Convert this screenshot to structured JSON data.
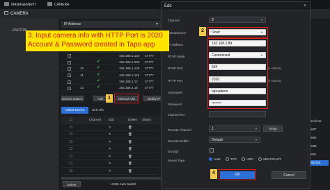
{
  "topbar": {
    "tabs": [
      {
        "label": "MANAGEMENT"
      },
      {
        "label": "CAMERA"
      }
    ],
    "close_label": "×"
  },
  "subbar": {
    "title": "CAMERA"
  },
  "sidebar": {
    "items": [
      {
        "label": "ENCODE"
      }
    ]
  },
  "main": {
    "ip_filter": {
      "value": "IP Address"
    },
    "device_rows": [
      {
        "num": "",
        "ip": "",
        "port": ""
      },
      {
        "num": "",
        "ip": "",
        "port": ""
      },
      {
        "num": "",
        "ip": "",
        "port": ""
      },
      {
        "num": "",
        "ip": "192.168.1.123",
        "port": "37777"
      },
      {
        "num": "",
        "ip": "192.168.1.233",
        "port": "37777"
      },
      {
        "num": "10",
        "ip": "192.168.1.128",
        "port": "37777"
      },
      {
        "num": "11",
        "ip": "192.168.1.119",
        "port": "37777"
      },
      {
        "num": "",
        "ip": "192.168.1.12",
        "port": "37777"
      },
      {
        "num": "13",
        "ip": "192.168.1.16",
        "port": "37777"
      }
    ],
    "buttons": {
      "device_search": "Device Search",
      "add": "Add",
      "manual_add": "Manual Add",
      "modify_ip": "Modify IP"
    },
    "tabs": {
      "added_device": "Added Device",
      "link_info": "Link Info"
    },
    "table_headers": {
      "channel": "Channel",
      "edit": "Edit",
      "delete": "Delete",
      "status": "Status"
    },
    "footer": {
      "delete": "Delete",
      "h265": "H.265 Auto Switch"
    }
  },
  "right_panel": {
    "rows": [
      "Serial No.",
      "7M07",
      "7M60",
      "7M28",
      "7M91",
      "WN7325"
    ]
  },
  "dialog": {
    "title": "Edit",
    "close": "×",
    "fields": {
      "channel": {
        "label": "Channel",
        "value": "8"
      },
      "manufacturer": {
        "label": "Manufacturer",
        "value": "Onvif"
      },
      "ip_address": {
        "label": "IP Address",
        "value": "192.168.2.89"
      },
      "rtsp_mode": {
        "label": "RTSP Mode",
        "value": "Customized"
      },
      "rtsp_port": {
        "label": "RTSP Port",
        "value": "554",
        "hint": "(1~65535)"
      },
      "http_port": {
        "label": "HTTP Port",
        "value": "2020",
        "hint": "(1~65535)"
      },
      "username": {
        "label": "Username",
        "value": "tapoadmin"
      },
      "password": {
        "label": "Password",
        "value": "••••••••"
      },
      "channel_no": {
        "label": "Channel No.",
        "value": ""
      },
      "remote_channel": {
        "label": "Remote Channel",
        "value": "1"
      },
      "decoder_buffer": {
        "label": "Decoder Buffer",
        "value": "Default"
      },
      "encrypt": {
        "label": "Encrypt"
      },
      "server_type": {
        "label": "Server Type",
        "options": [
          "Auto",
          "TCP",
          "UDP",
          "MULTICAST"
        ],
        "selected": "Auto"
      }
    },
    "setup_label": "Setup",
    "ok_label": "OK",
    "cancel_label": "Cancel"
  },
  "annotations": {
    "text_line1": "3. Input camera info with HTTP Port is 2020",
    "text_line2": "Account & Password created in Tapo app",
    "markers": {
      "m1": "1",
      "m2": "2",
      "m4": "4"
    }
  },
  "colors": {
    "accent": "#2c6fd6",
    "highlight": "#e02020",
    "note_bg": "#ffe600",
    "ok_check": "#3cbf4a"
  }
}
